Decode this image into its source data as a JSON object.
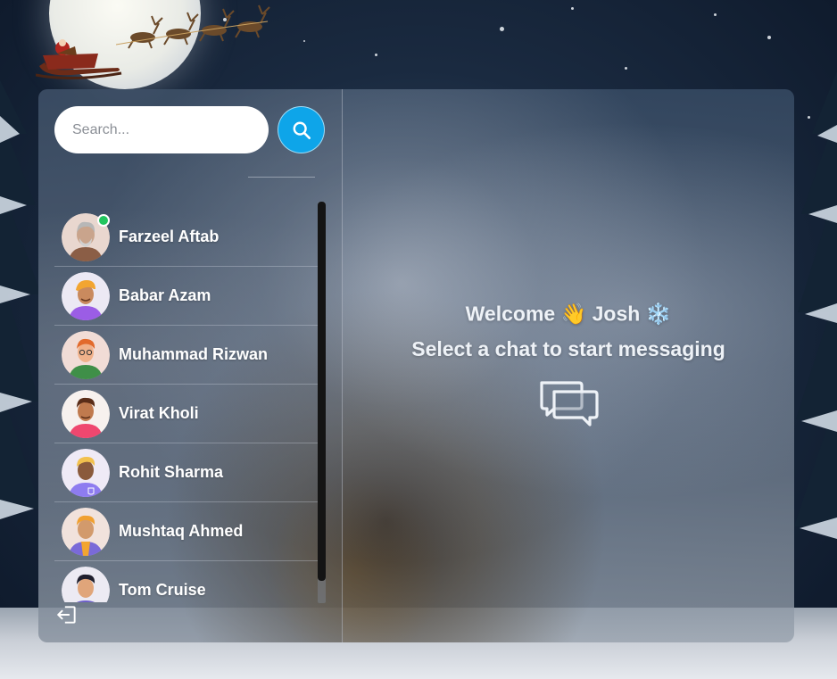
{
  "search": {
    "placeholder": "Search...",
    "button_icon": "search-icon"
  },
  "users": [
    {
      "name": "Farzeel Aftab",
      "online": true
    },
    {
      "name": "Babar Azam",
      "online": false
    },
    {
      "name": "Muhammad Rizwan",
      "online": false
    },
    {
      "name": "Virat Kholi",
      "online": false
    },
    {
      "name": "Rohit Sharma",
      "online": false
    },
    {
      "name": "Mushtaq Ahmed",
      "online": false
    },
    {
      "name": "Tom Cruise",
      "online": false
    }
  ],
  "sidebar": {
    "logout_icon": "logout-icon"
  },
  "chat": {
    "welcome_word": "Welcome",
    "wave_emoji": "👋",
    "user_name": "Josh",
    "snow_emoji": "❄️",
    "select_prompt": "Select a chat to start messaging",
    "empty_icon": "chat-bubbles-icon"
  },
  "colors": {
    "accent": "#0ea5e9",
    "online": "#22c55e",
    "scrollbar_thumb": "#141414"
  }
}
